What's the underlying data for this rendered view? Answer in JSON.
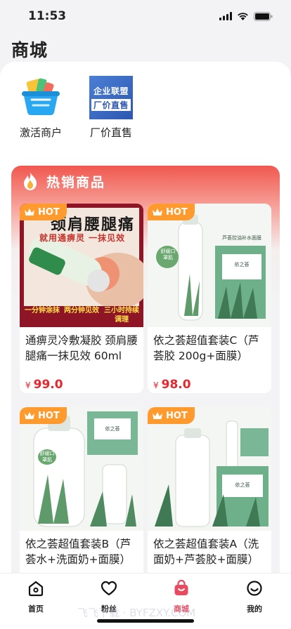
{
  "status_bar": {
    "time": "11:53"
  },
  "page_title": "商城",
  "shortcuts": [
    {
      "label": "激活商户",
      "icon": "shopping-basket-icon"
    },
    {
      "label": "厂价直售",
      "icon": "factory-direct-sale-icon",
      "icon_text_1": "企业联盟",
      "icon_text_2": "厂价直售"
    }
  ],
  "hot_section": {
    "title": "热销商品",
    "badge": "HOT"
  },
  "products": [
    {
      "name": "通痹灵冷敷凝胶 颈肩腰腿痛一抹见效 60ml",
      "price": "99.0",
      "currency": "¥",
      "image_texts": [
        "颈肩腰腿痛",
        "就用通痹灵 一抹见效",
        "一分钟涂抹",
        "两分钟见效",
        "三小时持续调理"
      ]
    },
    {
      "name": "依之荟超值套装C（芦荟胶 200g+面膜）",
      "price": "98.0",
      "currency": "¥",
      "image_texts": [
        "舒缓口罩肌",
        "芦荟控油补水面膜",
        "依之荟"
      ]
    },
    {
      "name": "依之荟超值套装B（芦荟水+洗面奶+面膜）",
      "image_texts": [
        "舒缓口罩肌",
        "依之荟"
      ]
    },
    {
      "name": "依之荟超值套装A（洗面奶+芦荟胶+面膜）",
      "image_texts": [
        "依之荟"
      ]
    }
  ],
  "tabs": [
    {
      "label": "首页",
      "icon": "home-icon"
    },
    {
      "label": "粉丝",
      "icon": "heart-icon"
    },
    {
      "label": "商城",
      "icon": "shopping-bag-icon",
      "active": true
    },
    {
      "label": "我的",
      "icon": "smiley-icon"
    }
  ],
  "watermark": "飞飞下载 · BYFZXY.COM",
  "colors": {
    "accent": "#e84a5f",
    "price": "#e8262b",
    "hot_badge": "#ff9a2e",
    "section_gradient_top": "#f0584f"
  }
}
